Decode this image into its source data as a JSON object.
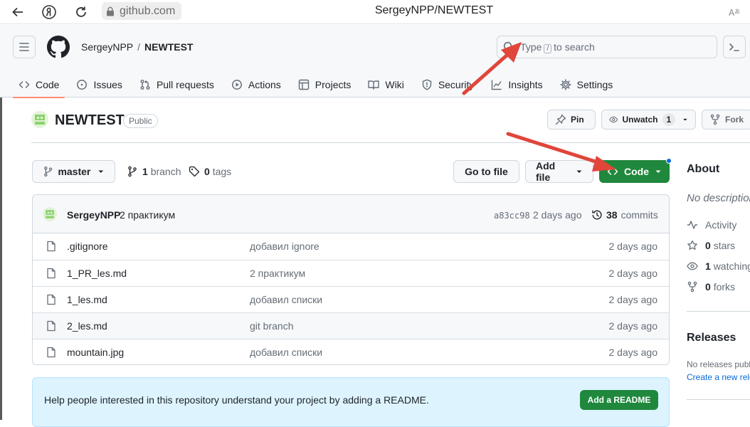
{
  "browser": {
    "domain": "github.com",
    "title": "SergeyNPP/NEWTEST"
  },
  "header": {
    "owner": "SergeyNPP",
    "separator": "/",
    "repo": "NEWTEST",
    "search": {
      "before": "Type",
      "key": "/",
      "after": "to search"
    }
  },
  "nav": {
    "tabs": [
      {
        "label": "Code",
        "icon": "code-icon",
        "active": true
      },
      {
        "label": "Issues",
        "icon": "issue-icon"
      },
      {
        "label": "Pull requests",
        "icon": "pull-request-icon"
      },
      {
        "label": "Actions",
        "icon": "play-icon"
      },
      {
        "label": "Projects",
        "icon": "table-icon"
      },
      {
        "label": "Wiki",
        "icon": "book-icon"
      },
      {
        "label": "Security",
        "icon": "shield-icon"
      },
      {
        "label": "Insights",
        "icon": "graph-icon"
      },
      {
        "label": "Settings",
        "icon": "gear-icon"
      }
    ]
  },
  "repo_head": {
    "name": "NEWTEST",
    "visibility": "Public",
    "pin": "Pin",
    "unwatch": "Unwatch",
    "watch_count": "1",
    "fork": "Fork"
  },
  "toolbar": {
    "branch": "master",
    "branch_count": "1",
    "branch_word": "branch",
    "tag_count": "0",
    "tag_word": "tags",
    "goto_file": "Go to file",
    "add_file": "Add file",
    "code": "Code"
  },
  "commit": {
    "user": "SergeyNPP",
    "message": "2 практикум",
    "sha": "a83cc98",
    "time": "2 days ago",
    "count": "38",
    "count_word": "commits"
  },
  "files": [
    {
      "name": ".gitignore",
      "message": "добавил ignore",
      "date": "2 days ago"
    },
    {
      "name": "1_PR_les.md",
      "message": "2 практикум",
      "date": "2 days ago"
    },
    {
      "name": "1_les.md",
      "message": "добавил списки",
      "date": "2 days ago"
    },
    {
      "name": "2_les.md",
      "message": "git branch",
      "date": "2 days ago"
    },
    {
      "name": "mountain.jpg",
      "message": "добавил списки",
      "date": "2 days ago"
    }
  ],
  "readme": {
    "text": "Help people interested in this repository understand your project by adding a README.",
    "button": "Add a README"
  },
  "sidebar": {
    "about": "About",
    "description": "No description",
    "activity": "Activity",
    "stars_count": "0",
    "stars_word": "stars",
    "watching_count": "1",
    "watching_word": "watching",
    "forks_count": "0",
    "forks_word": "forks",
    "releases": "Releases",
    "no_releases": "No releases published",
    "create_release": "Create a new release"
  },
  "colors": {
    "primary_green": "#1f883d",
    "active_tab_underline": "#fd8c73",
    "annotation_arrow": "#e0463a",
    "link_blue": "#0969da"
  }
}
